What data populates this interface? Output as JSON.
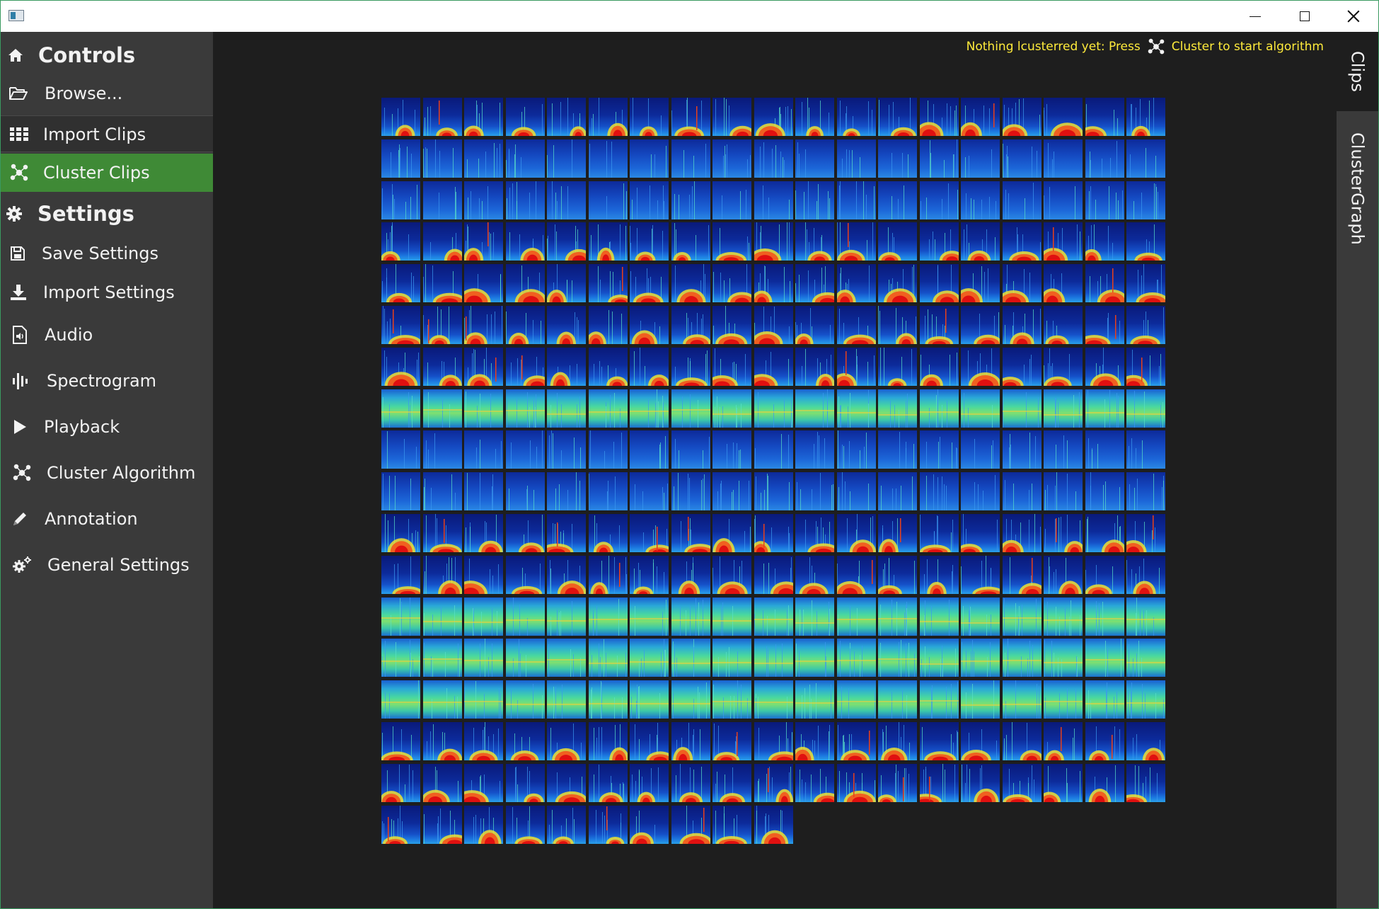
{
  "window": {
    "controls": {
      "minimize_icon": "minimize-icon",
      "maximize_icon": "maximize-icon",
      "close_icon": "close-icon"
    }
  },
  "sidebar": {
    "controls_header": {
      "label": "Controls",
      "icon": "home-icon"
    },
    "browse": {
      "label": "Browse...",
      "icon": "folder-open-icon"
    },
    "import_clips": {
      "label": "Import Clips",
      "icon": "grid-icon"
    },
    "cluster_clips": {
      "label": "Cluster Clips",
      "icon": "cluster-icon",
      "active": true
    },
    "settings_header": {
      "label": "Settings",
      "icon": "gear-icon"
    },
    "save_settings": {
      "label": "Save Settings",
      "icon": "floppy-icon"
    },
    "import_settings": {
      "label": "Import Settings",
      "icon": "download-icon"
    },
    "audio": {
      "label": "Audio",
      "icon": "audio-file-icon"
    },
    "spectrogram": {
      "label": "Spectrogram",
      "icon": "spectrogram-icon"
    },
    "playback": {
      "label": "Playback",
      "icon": "play-icon"
    },
    "cluster_algorithm": {
      "label": "Cluster Algorithm",
      "icon": "cluster-icon"
    },
    "annotation": {
      "label": "Annotation",
      "icon": "pencil-icon"
    },
    "general_settings": {
      "label": "General Settings",
      "icon": "gears-icon"
    }
  },
  "status": {
    "prefix": "Nothing lcusterred yet: Press",
    "suffix": "Cluster to start algorithm",
    "color": "#ffeb3b"
  },
  "tabs": {
    "clips": "Clips",
    "cluster_graph": "ClusterGraph"
  },
  "colors": {
    "sidebar_bg": "#3a3a3a",
    "active_item": "#3f8a36",
    "main_bg": "#1e1e1e",
    "window_border": "#3a9a60"
  },
  "clip_grid": {
    "columns": 19,
    "row_counts": [
      19,
      19,
      19,
      19,
      19,
      19,
      19,
      19,
      19,
      19,
      19,
      19,
      19,
      19,
      19,
      19,
      19,
      10
    ],
    "row_styles": [
      "call",
      "noise",
      "noise",
      "call",
      "call",
      "call",
      "call",
      "band",
      "noise",
      "noise",
      "call",
      "call",
      "band",
      "band",
      "band",
      "call",
      "call",
      "call"
    ]
  }
}
